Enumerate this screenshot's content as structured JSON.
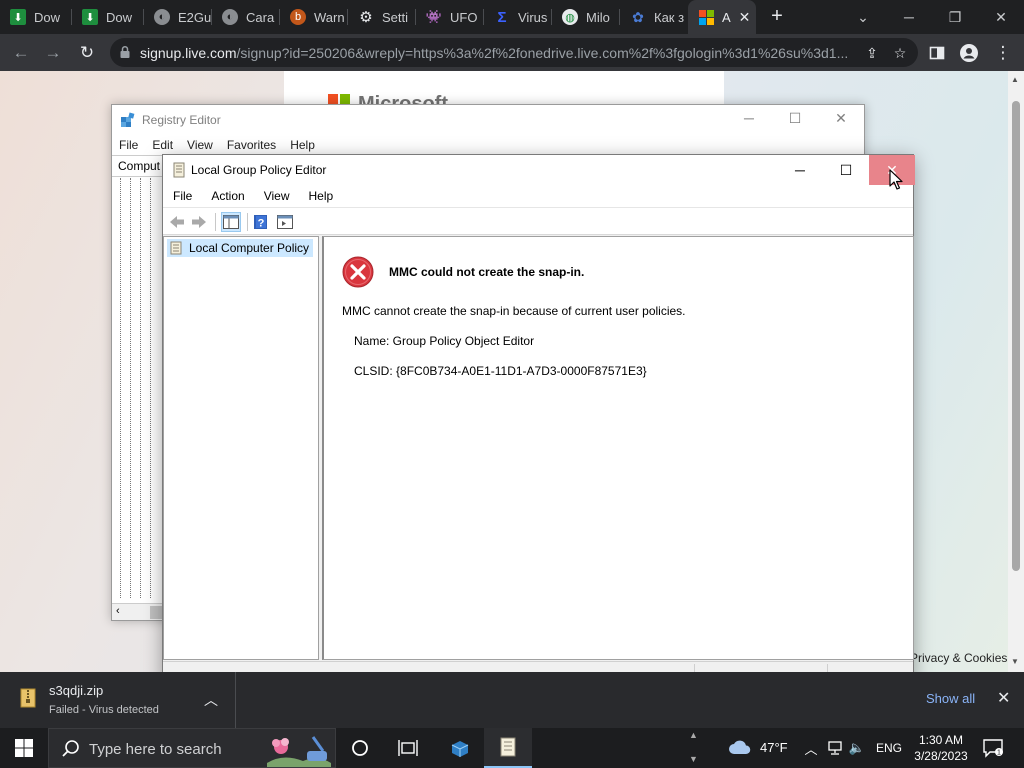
{
  "browser": {
    "tabs": [
      {
        "label": "Dow",
        "icon": "download-icon"
      },
      {
        "label": "Dow",
        "icon": "download-icon"
      },
      {
        "label": "E2Gu",
        "icon": "globe-icon"
      },
      {
        "label": "Cara",
        "icon": "globe-icon"
      },
      {
        "label": "Warn",
        "icon": "warning-site-icon"
      },
      {
        "label": "Setti",
        "icon": "gear-icon"
      },
      {
        "label": "UFO",
        "icon": "ufo-icon"
      },
      {
        "label": "Virus",
        "icon": "virustotal-icon"
      },
      {
        "label": "Milo",
        "icon": "milo-icon"
      },
      {
        "label": "Как з",
        "icon": "blue-logo-icon"
      },
      {
        "label": "A",
        "icon": "microsoft-icon",
        "active": true
      }
    ],
    "url_host": "signup.live.com",
    "url_path": "/signup?id=250206&wreply=https%3a%2f%2fonedrive.live.com%2f%3fgologin%3d1%26su%3d1..."
  },
  "webpage": {
    "brand": "Microsoft",
    "footer_link": "Privacy & Cookies"
  },
  "registry_editor": {
    "title": "Registry Editor",
    "menu": [
      "File",
      "Edit",
      "View",
      "Favorites",
      "Help"
    ],
    "tree_header": "Comput"
  },
  "gpedit": {
    "title": "Local Group Policy Editor",
    "menu": [
      "File",
      "Action",
      "View",
      "Help"
    ],
    "tree_item": "Local Computer Policy",
    "error_title": "MMC could not create the snap-in.",
    "error_message": "MMC cannot create the snap-in because of current user policies.",
    "error_name": "Name: Group Policy Object Editor",
    "error_clsid": "CLSID: {8FC0B734-A0E1-11D1-A7D3-0000F87571E3}"
  },
  "download_shelf": {
    "file_name": "s3qdji.zip",
    "status": "Failed - Virus detected",
    "show_all": "Show all"
  },
  "taskbar": {
    "search_placeholder": "Type here to search",
    "temperature": "47°F",
    "language": "ENG",
    "time": "1:30 AM",
    "date": "3/28/2023"
  },
  "colors": {
    "chrome_dark": "#35363a",
    "close_hover": "#e8848b",
    "error_red": "#d9363e",
    "link_blue": "#8ab4f8"
  }
}
